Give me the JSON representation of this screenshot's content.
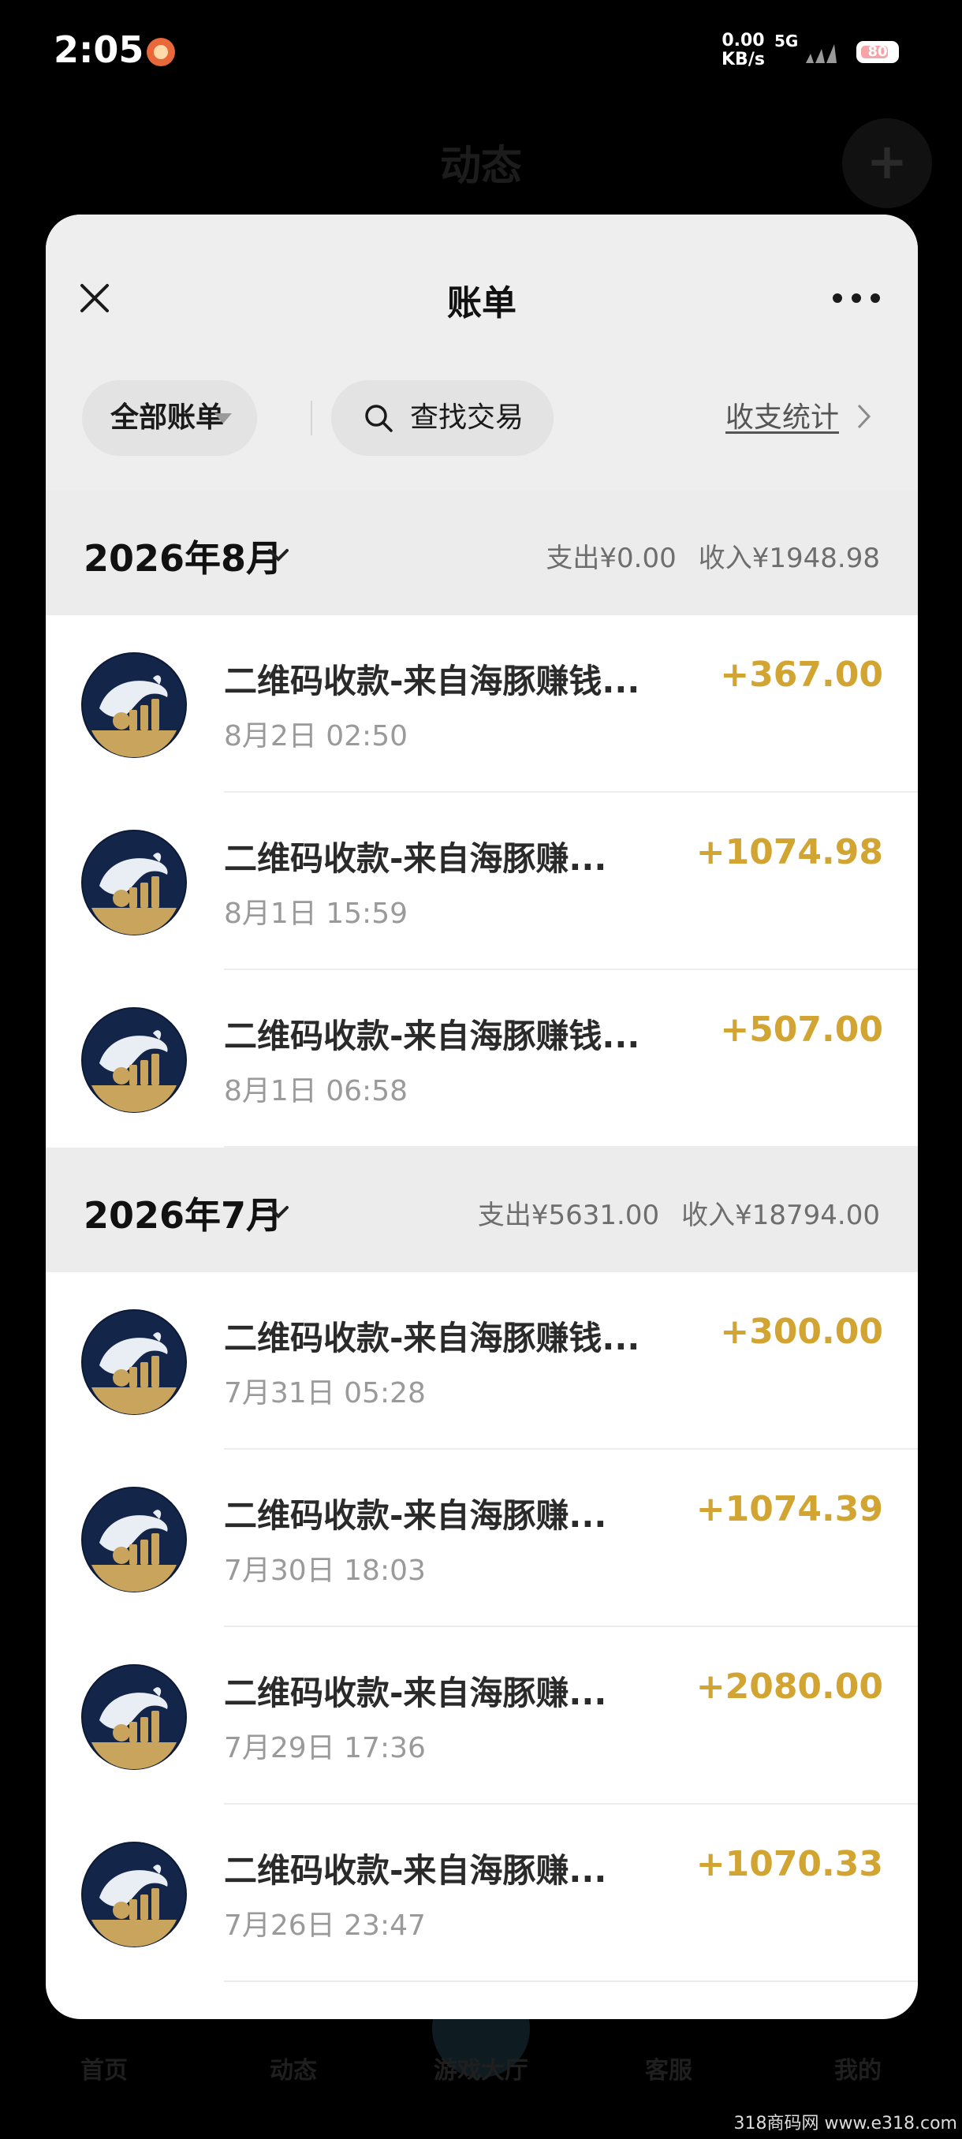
{
  "status_bar": {
    "time": "2:05",
    "net_speed_value": "0.00",
    "net_speed_unit": "KB/s",
    "network_type": "5G",
    "battery": "80"
  },
  "background_app": {
    "title": "动态",
    "plus_label": "+",
    "tabs": [
      "首页",
      "动态",
      "游戏大厅",
      "客服",
      "我的"
    ]
  },
  "sheet": {
    "title": "账单",
    "filter_label": "全部账单",
    "search_label": "查找交易",
    "stats_label": "收支统计"
  },
  "months": [
    {
      "label": "2026年8月",
      "expense": "支出¥0.00",
      "income": "收入¥1948.98",
      "transactions": [
        {
          "title": "二维码收款-来自海豚赚钱...",
          "time": "8月2日 02:50",
          "amount": "+367.00"
        },
        {
          "title": "二维码收款-来自海豚赚...",
          "time": "8月1日 15:59",
          "amount": "+1074.98"
        },
        {
          "title": "二维码收款-来自海豚赚钱...",
          "time": "8月1日 06:58",
          "amount": "+507.00"
        }
      ]
    },
    {
      "label": "2026年7月",
      "expense": "支出¥5631.00",
      "income": "收入¥18794.00",
      "transactions": [
        {
          "title": "二维码收款-来自海豚赚钱...",
          "time": "7月31日 05:28",
          "amount": "+300.00"
        },
        {
          "title": "二维码收款-来自海豚赚...",
          "time": "7月30日 18:03",
          "amount": "+1074.39"
        },
        {
          "title": "二维码收款-来自海豚赚...",
          "time": "7月29日 17:36",
          "amount": "+2080.00"
        },
        {
          "title": "二维码收款-来自海豚赚...",
          "time": "7月26日 23:47",
          "amount": "+1070.33"
        }
      ]
    }
  ],
  "avatar_text": "海豚赚钱",
  "watermark": "318商码网 www.e318.com",
  "colors": {
    "amount": "#d2a431",
    "avatar_bg": "#14254a",
    "avatar_gold": "#c9a45c"
  }
}
